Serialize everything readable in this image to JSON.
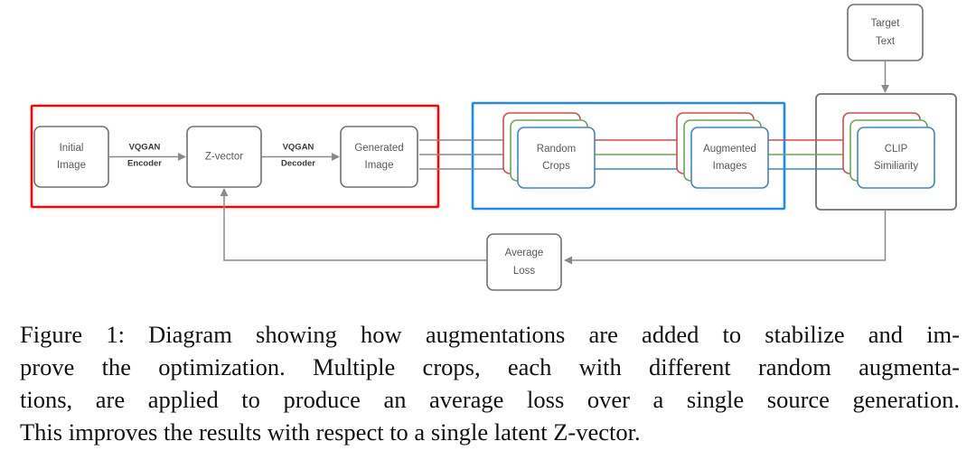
{
  "figure": {
    "nodes": {
      "initial_image": "Initial\nImage",
      "initial_image_l1": "Initial",
      "initial_image_l2": "Image",
      "z_vector": "Z-vector",
      "generated_image_l1": "Generated",
      "generated_image_l2": "Image",
      "random_crops_l1": "Random",
      "random_crops_l2": "Crops",
      "augmented_images_l1": "Augmented",
      "augmented_images_l2": "Images",
      "clip_similarity_l1": "CLIP",
      "clip_similarity_l2": "Similiarity",
      "target_text_l1": "Target",
      "target_text_l2": "Text",
      "average_loss_l1": "Average",
      "average_loss_l2": "Loss"
    },
    "edge_labels": {
      "encoder_l1": "VQGAN",
      "encoder_l2": "Encoder",
      "decoder_l1": "VQGAN",
      "decoder_l2": "Decoder"
    },
    "colors": {
      "group_red": "#ff0000",
      "group_blue": "#1a8cf0",
      "group_gray": "#707070",
      "stack_red": "#d64b4b",
      "stack_green": "#6aa84f",
      "stack_blue": "#3d85c8",
      "wire_gray": "#8a8a8a",
      "node_text": "#595959"
    }
  },
  "caption": {
    "line1": "Figure 1: Diagram showing how augmentations are added to stabilize and im-",
    "line2": "prove the optimization. Multiple crops, each with different random augmenta-",
    "line3": "tions, are applied to produce an average loss over a single source generation.",
    "line4": "This improves the results with respect to a single latent Z-vector."
  }
}
